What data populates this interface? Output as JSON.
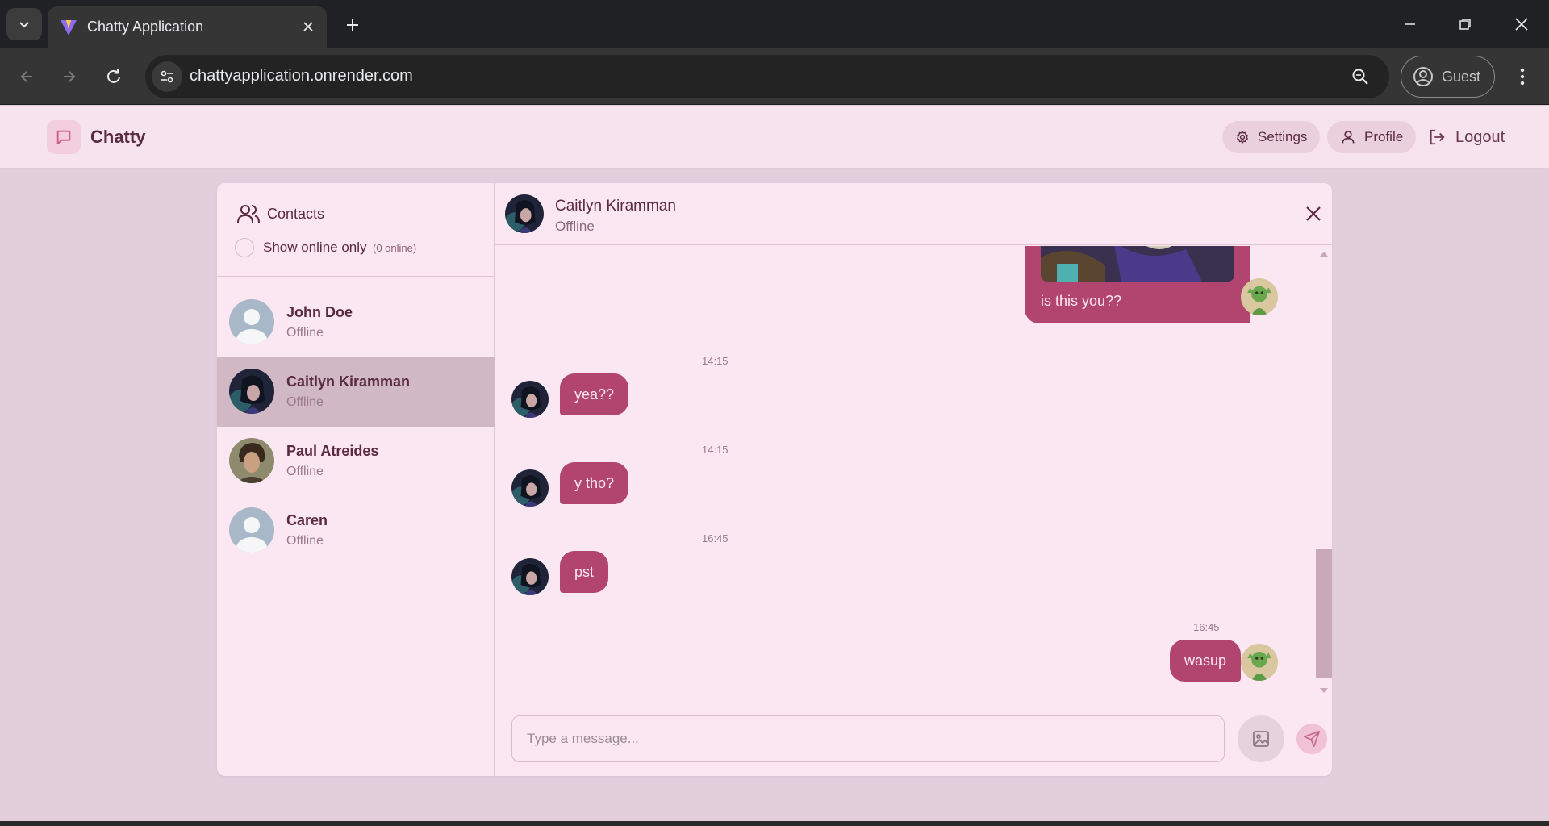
{
  "browser": {
    "tab_title": "Chatty Application",
    "url": "chattyapplication.onrender.com",
    "profile_label": "Guest"
  },
  "header": {
    "app_name": "Chatty",
    "settings_label": "Settings",
    "profile_label": "Profile",
    "logout_label": "Logout"
  },
  "sidebar": {
    "title": "Contacts",
    "filter_label": "Show online only",
    "online_count": "(0 online)",
    "contacts": [
      {
        "name": "John Doe",
        "status": "Offline",
        "avatar": "default-avatar"
      },
      {
        "name": "Caitlyn Kiramman",
        "status": "Offline",
        "avatar": "photo-avatar",
        "selected": true
      },
      {
        "name": "Paul Atreides",
        "status": "Offline",
        "avatar": "photo-avatar"
      },
      {
        "name": "Caren",
        "status": "Offline",
        "avatar": "default-avatar"
      }
    ]
  },
  "chat": {
    "contact_name": "Caitlyn Kiramman",
    "contact_status": "Offline",
    "messages": [
      {
        "side": "right",
        "type": "image+text",
        "text": "is this you??"
      },
      {
        "side": "left",
        "time": "14:15",
        "text": "yea??"
      },
      {
        "side": "left",
        "time": "14:15",
        "text": "y tho?"
      },
      {
        "side": "left",
        "time": "16:45",
        "text": "pst"
      },
      {
        "side": "right",
        "time": "16:45",
        "text": "wasup"
      }
    ],
    "composer_placeholder": "Type a message..."
  },
  "colors": {
    "accent": "#b14570",
    "panel": "#fbe7f2",
    "page_bg": "#e3cfdc"
  }
}
